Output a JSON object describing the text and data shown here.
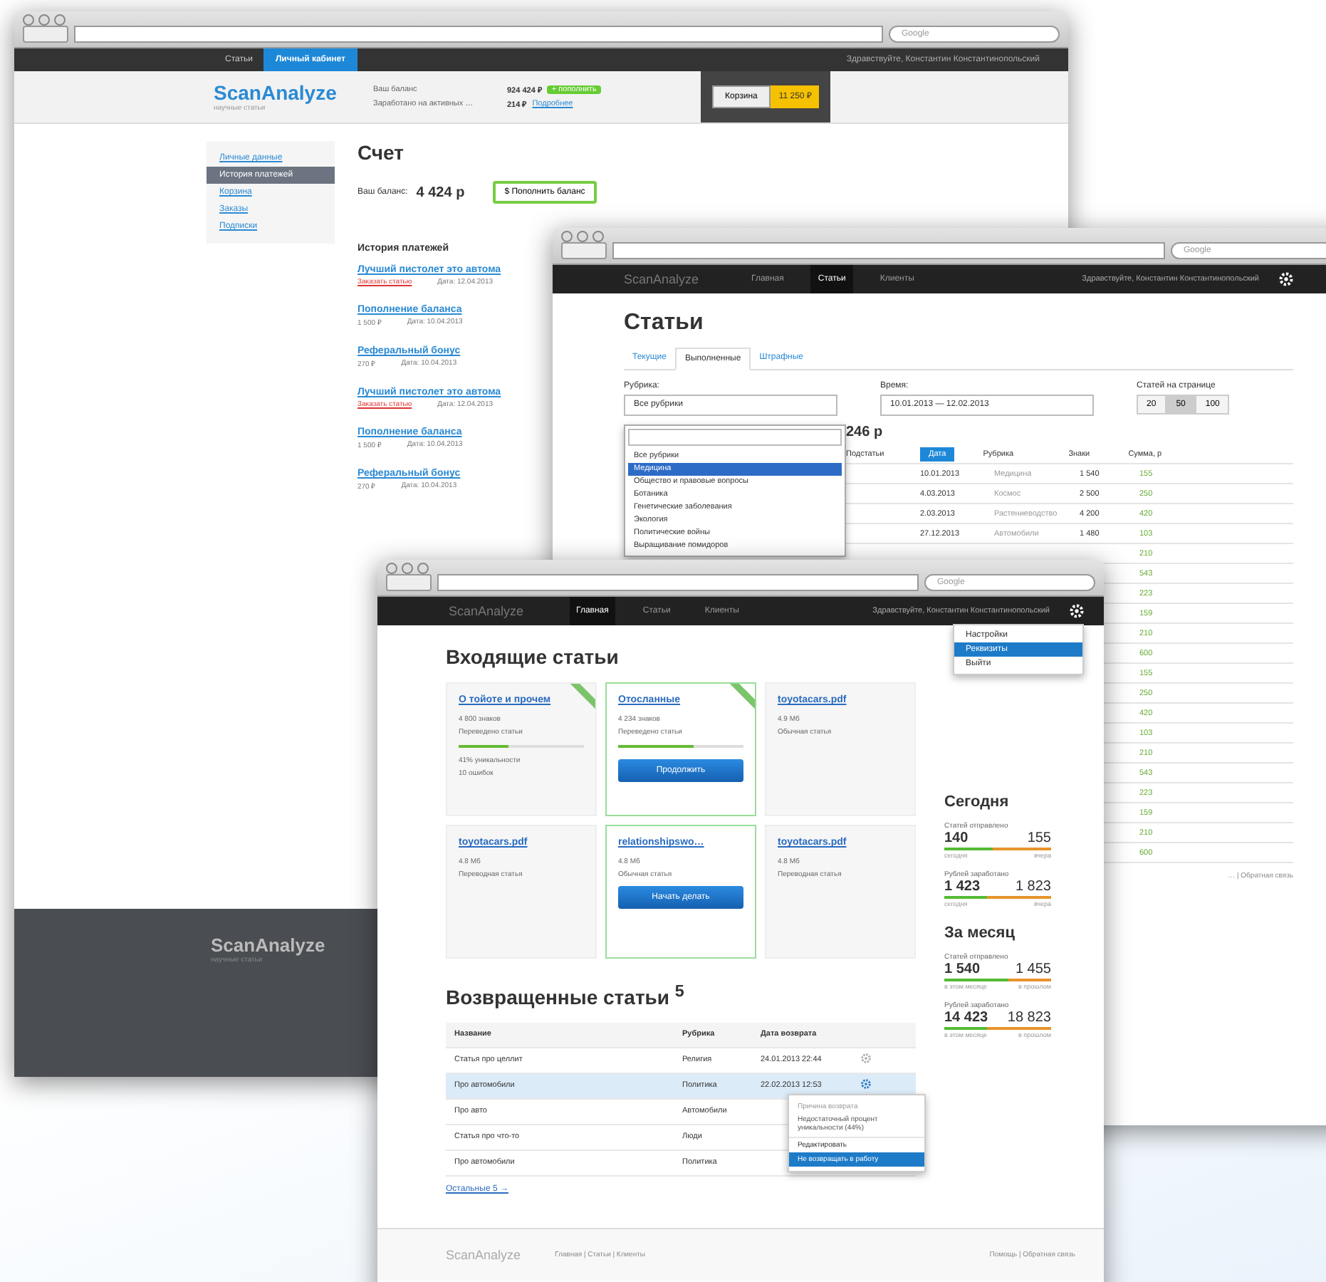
{
  "account_window": {
    "browser_search": "Google",
    "nav": [
      {
        "label": "Статьи",
        "selected": false
      },
      {
        "label": "Личный кабинет",
        "selected": true
      }
    ],
    "greeting": "Здравствуйте, Константин Константинопольский",
    "logo": "ScanAnalyze",
    "logo_sub": "научные статьи",
    "header_stats": [
      {
        "label": "Ваш баланс",
        "value": "924 424 ₽",
        "badge": "+ пополнить"
      },
      {
        "label": "Заработано на активных …",
        "value": "214 ₽",
        "link": "Подробнее"
      }
    ],
    "cart_button": "Корзина",
    "cart_total": "11 250 ₽",
    "sidebar": [
      {
        "label": "Личные данные",
        "selected": false
      },
      {
        "label": "История платежей",
        "selected": true
      },
      {
        "label": "Корзина",
        "selected": false
      },
      {
        "label": "Заказы",
        "selected": false
      },
      {
        "label": "Подписки",
        "selected": false
      }
    ],
    "title": "Счет",
    "balance_label": "Ваш баланс:",
    "balance": "4 424 р",
    "topup_button": "$ Пополнить баланс",
    "history_title": "История платежей",
    "history": [
      {
        "title": "Лучший пистолет это автома",
        "kind": "purchase",
        "note": "Заказать статью",
        "date": "Дата: 12.04.2013"
      },
      {
        "title": "Пополнение баланса",
        "kind": "topup",
        "note": "1 500 ₽",
        "date": "Дата: 10.04.2013"
      },
      {
        "title": "Реферальный бонус",
        "kind": "topup",
        "note": "270 ₽",
        "date": "Дата: 10.04.2013"
      },
      {
        "title": "Лучший пистолет это автома",
        "kind": "purchase",
        "note": "Заказать статью",
        "date": "Дата: 12.04.2013"
      },
      {
        "title": "Пополнение баланса",
        "kind": "topup",
        "note": "1 500 ₽",
        "date": "Дата: 10.04.2013"
      },
      {
        "title": "Реферальный бонус",
        "kind": "topup",
        "note": "270 ₽",
        "date": "Дата: 10.04.2013"
      }
    ],
    "footer_logo": "ScanAnalyze",
    "footer_sub": "научные статьи"
  },
  "articles_window": {
    "browser_search": "Google",
    "logo": "ScanAnalyze",
    "nav": [
      {
        "label": "Главная",
        "selected": false
      },
      {
        "label": "Статьи",
        "selected": true
      },
      {
        "label": "Клиенты",
        "selected": false
      }
    ],
    "greeting": "Здравствуйте, Константин Константинопольский",
    "title": "Статьи",
    "tabs": [
      {
        "label": "Текущие",
        "selected": false
      },
      {
        "label": "Выполненные",
        "selected": true
      },
      {
        "label": "Штрафные",
        "selected": false
      }
    ],
    "rubric_label": "Рубрика:",
    "rubric_value": "Все рубрики",
    "rubric_options": [
      {
        "label": "Все рубрики",
        "selected": false
      },
      {
        "label": "Медицина",
        "selected": true
      },
      {
        "label": "Общество и правовые вопросы",
        "selected": false
      },
      {
        "label": "Ботаника",
        "selected": false
      },
      {
        "label": "Генетические заболевания",
        "selected": false
      },
      {
        "label": "Экология",
        "selected": false
      },
      {
        "label": "Политические войны",
        "selected": false
      },
      {
        "label": "Выращивание помидоров",
        "selected": false
      }
    ],
    "time_label": "Время:",
    "time_value": "10.01.2013 — 12.02.2013",
    "per_page_label": "Статей на странице",
    "per_page": [
      {
        "label": "20",
        "selected": false
      },
      {
        "label": "50",
        "selected": true
      },
      {
        "label": "100",
        "selected": false
      }
    ],
    "total": "246 р",
    "columns": [
      "Подстатьи",
      "Дата",
      "Рубрика",
      "Знаки",
      "Сумма, р"
    ],
    "rows": [
      {
        "date": "10.01.2013",
        "rubric": "Медицина",
        "chars": "1 540",
        "sum": "155"
      },
      {
        "date": "4.03.2013",
        "rubric": "Космос",
        "chars": "2 500",
        "sum": "250"
      },
      {
        "date": "2.03.2013",
        "rubric": "Растениеводство",
        "chars": "4 200",
        "sum": "420"
      },
      {
        "date": "27.12.2013",
        "rubric": "Автомобили",
        "chars": "1 480",
        "sum": "103"
      },
      {
        "sum": "210"
      },
      {
        "sum": "543"
      },
      {
        "sum": "223"
      },
      {
        "sum": "159"
      },
      {
        "sum": "210"
      },
      {
        "sum": "600"
      },
      {
        "sum": "155"
      },
      {
        "sum": "250"
      },
      {
        "sum": "420"
      },
      {
        "sum": "103"
      },
      {
        "sum": "210"
      },
      {
        "sum": "543"
      },
      {
        "sum": "223"
      },
      {
        "sum": "159"
      },
      {
        "sum": "210"
      },
      {
        "sum": "600"
      }
    ],
    "footer_links": "… | Обратная связь"
  },
  "home_window": {
    "browser_search": "Google",
    "logo": "ScanAnalyze",
    "nav": [
      {
        "label": "Главная",
        "selected": true
      },
      {
        "label": "Статьи",
        "selected": false
      },
      {
        "label": "Клиенты",
        "selected": false
      }
    ],
    "greeting": "Здравствуйте, Константин Константинопольский",
    "user_menu": [
      {
        "label": "Настройки",
        "selected": false
      },
      {
        "label": "Реквизиты",
        "selected": true
      },
      {
        "label": "Выйти",
        "selected": false
      }
    ],
    "title": "Входящие статьи",
    "cards": [
      {
        "title": "О тойоте и прочем",
        "lines": [
          "4 800 знаков",
          "Переведено статьи"
        ],
        "level": 0.4,
        "after": [
          "41% уникальности",
          "10 ошибок"
        ],
        "ribbon": true,
        "highlighted": false
      },
      {
        "title": "Отосланные",
        "lines": [
          "4 234 знаков",
          "Переведено статьи"
        ],
        "level": 0.6,
        "button": "Продолжить",
        "ribbon": true,
        "highlighted": true
      },
      {
        "title": "toyotacars.pdf",
        "lines": [
          "4.9 Мб",
          "Обычная статья"
        ],
        "ribbon": false,
        "highlighted": false
      },
      {
        "title": "toyotacars.pdf",
        "lines": [
          "4.8 Мб",
          "Переводная статья"
        ],
        "ribbon": false,
        "highlighted": false
      },
      {
        "title": "relationshipswo…",
        "lines": [
          "4.8 Мб",
          "Обычная статья"
        ],
        "button": "Начать делать",
        "ribbon": false,
        "highlighted": true
      },
      {
        "title": "toyotacars.pdf",
        "lines": [
          "4.8 Мб",
          "Переводная статья"
        ],
        "ribbon": false,
        "highlighted": false
      }
    ],
    "stats": [
      {
        "heading": "Сегодня",
        "items": [
          {
            "label": "Статей отправлено",
            "a": "140",
            "b": "155",
            "level": 0.45,
            "a_label": "сегодня",
            "b_label": "вчера"
          },
          {
            "label": "Рублей заработано",
            "a": "1 423",
            "b": "1 823",
            "level": 0.4,
            "a_label": "сегодня",
            "b_label": "вчера"
          }
        ]
      },
      {
        "heading": "За месяц",
        "items": [
          {
            "label": "Статей отправлено",
            "a": "1 540",
            "b": "1 455",
            "level": 0.6,
            "a_label": "в этом месяце",
            "b_label": "в прошлом"
          },
          {
            "label": "Рублей заработано",
            "a": "14 423",
            "b": "18 823",
            "level": 0.4,
            "a_label": "в этом месяце",
            "b_label": "в прошлом"
          }
        ]
      }
    ],
    "returned_title": "Возвращенные статьи $^{5}$",
    "returned_columns": [
      "Название",
      "Рубрика",
      "Дата возврата"
    ],
    "returned_rows": [
      {
        "name": "Статья про целлит",
        "rubric": "Религия",
        "date": "24.01.2013 22:44",
        "selected": false
      },
      {
        "name": "Про автомобили",
        "rubric": "Политика",
        "date": "22.02.2013 12:53",
        "selected": true
      },
      {
        "name": "Про авто",
        "rubric": "Автомобили",
        "selected": false
      },
      {
        "name": "Статья про что-то",
        "rubric": "Люди",
        "selected": false
      },
      {
        "name": "Про автомобили",
        "rubric": "Политика",
        "selected": false
      }
    ],
    "row_menu": [
      {
        "label": "Причина возврата",
        "kind": "header",
        "selected": false
      },
      {
        "label": "Недостаточный процент уникальности (44%)",
        "kind": "text",
        "selected": false
      },
      {
        "label": "Редактировать",
        "kind": "item",
        "selected": false
      },
      {
        "label": "Не возвращать в работу",
        "kind": "item",
        "selected": true
      }
    ],
    "more_link": "Остальные 5 →",
    "footer_logo": "ScanAnalyze",
    "footer_links": "Главная | Статьи | Клиенты",
    "footer_right": "Помощь | Обратная связь"
  }
}
